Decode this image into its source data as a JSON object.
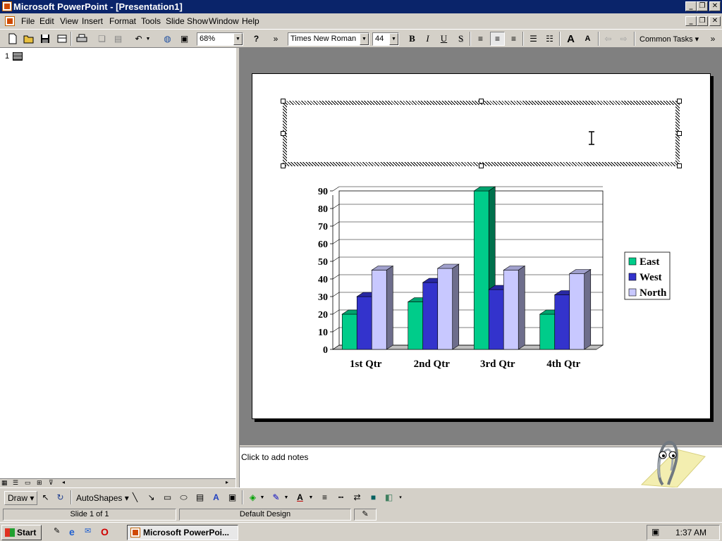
{
  "window": {
    "title": "Microsoft PowerPoint - [Presentation1]",
    "controls": [
      "_",
      "❐",
      "✕"
    ]
  },
  "menubar": {
    "items": [
      "File",
      "Edit",
      "View",
      "Insert",
      "Format",
      "Tools",
      "Slide Show",
      "Window",
      "Help"
    ]
  },
  "toolbar": {
    "zoom": "68%",
    "font_name": "Times New Roman",
    "font_size": "44",
    "bold": "B",
    "italic": "I",
    "underline": "U",
    "shadow": "S",
    "grow_font": "A",
    "shrink_font": "A",
    "common_tasks": "Common Tasks",
    "overflow": "»"
  },
  "outline": {
    "slide_number": "1"
  },
  "slide": {
    "title_placeholder": "",
    "chart_data": {
      "type": "bar",
      "categories": [
        "1st Qtr",
        "2nd Qtr",
        "3rd Qtr",
        "4th Qtr"
      ],
      "series": [
        {
          "name": "East",
          "values": [
            20,
            27,
            90,
            20
          ],
          "color": "#00cc8a"
        },
        {
          "name": "West",
          "values": [
            30,
            38,
            34,
            31
          ],
          "color": "#3333cc"
        },
        {
          "name": "North",
          "values": [
            45,
            46,
            45,
            43
          ],
          "color": "#c8c8ff"
        }
      ],
      "ylim": [
        0,
        90
      ],
      "yticks": [
        "0",
        "10",
        "20",
        "30",
        "40",
        "50",
        "60",
        "70",
        "80",
        "90"
      ],
      "grid": true,
      "legend": "right"
    }
  },
  "notes": {
    "placeholder": "Click to add notes"
  },
  "drawbar": {
    "draw_label": "Draw",
    "autoshapes_label": "AutoShapes"
  },
  "statusbar": {
    "slide": "Slide 1 of 1",
    "design": "Default Design"
  },
  "taskbar": {
    "start": "Start",
    "task": "Microsoft PowerPoi...",
    "time": "1:37 AM"
  }
}
